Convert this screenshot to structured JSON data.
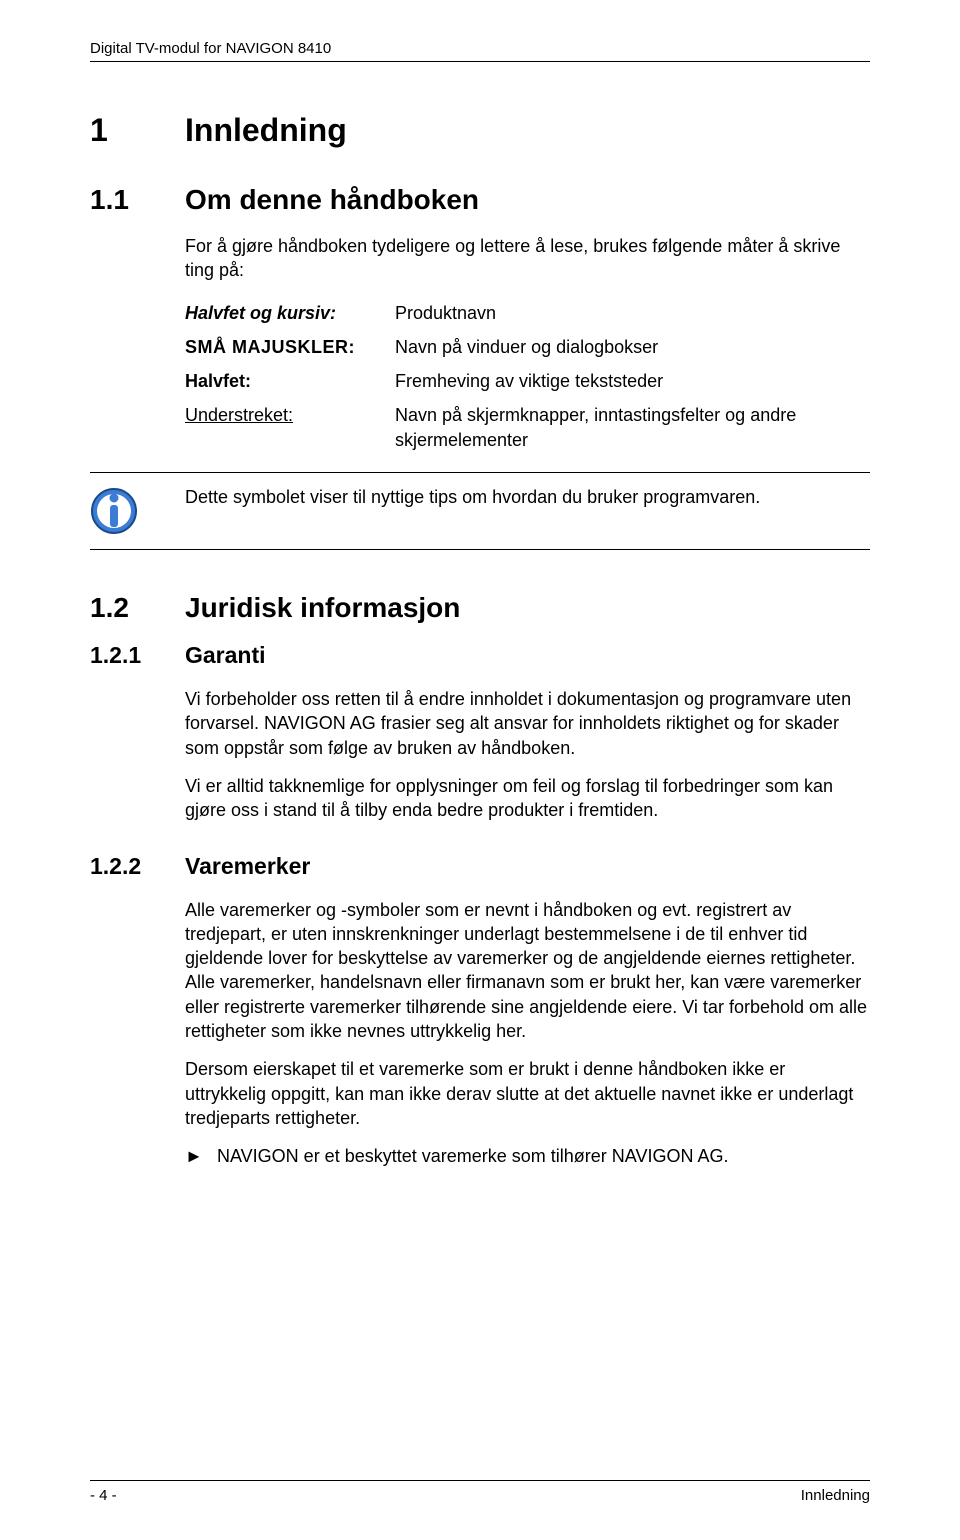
{
  "header": "Digital TV-modul for NAVIGON 8410",
  "s1": {
    "num": "1",
    "title": "Innledning"
  },
  "s11": {
    "num": "1.1",
    "title": "Om denne håndboken",
    "intro": "For å gjøre håndboken tydeligere og lettere å lese, brukes følgende måter å skrive ting på:",
    "rows": [
      {
        "left": "Halvfet og kursiv:",
        "right": "Produktnavn"
      },
      {
        "left": "SMÅ MAJUSKLER:",
        "right": "Navn på vinduer og dialogbokser"
      },
      {
        "left": "Halvfet:",
        "right": "Fremheving av viktige tekststeder"
      },
      {
        "left": "Understreket:",
        "right": "Navn på skjermknapper, inntastingsfelter og andre skjermelementer"
      }
    ],
    "tip": "Dette symbolet viser til nyttige tips om hvordan du bruker programvaren."
  },
  "s12": {
    "num": "1.2",
    "title": "Juridisk informasjon"
  },
  "s121": {
    "num": "1.2.1",
    "title": "Garanti",
    "p1": "Vi forbeholder oss retten til å endre innholdet i dokumentasjon og programvare uten forvarsel. NAVIGON AG frasier seg alt ansvar for innholdets riktighet og for skader som oppstår som følge av bruken av håndboken.",
    "p2": "Vi er alltid takknemlige for opplysninger om feil og forslag til forbedringer som kan gjøre oss i stand til å tilby enda bedre produkter i fremtiden."
  },
  "s122": {
    "num": "1.2.2",
    "title": "Varemerker",
    "p1": "Alle varemerker og -symboler som er nevnt i håndboken og evt. registrert av tredjepart, er uten innskrenkninger underlagt bestemmelsene i de til enhver tid gjeldende lover for beskyttelse av varemerker og de angjeldende eiernes rettigheter. Alle varemerker, handelsnavn eller firmanavn som er brukt her, kan være varemerker eller registrerte varemerker tilhørende sine angjeldende eiere. Vi tar forbehold om alle rettigheter som ikke nevnes uttrykkelig her.",
    "p2": "Dersom eierskapet til et varemerke som er brukt i denne håndboken ikke er uttrykkelig oppgitt, kan man ikke derav slutte at det aktuelle navnet ikke er underlagt tredjeparts rettigheter.",
    "bullet_mark": "►",
    "bullet": "NAVIGON er et beskyttet varemerke som tilhører NAVIGON AG."
  },
  "footer": {
    "left": "- 4 -",
    "right": "Innledning"
  }
}
